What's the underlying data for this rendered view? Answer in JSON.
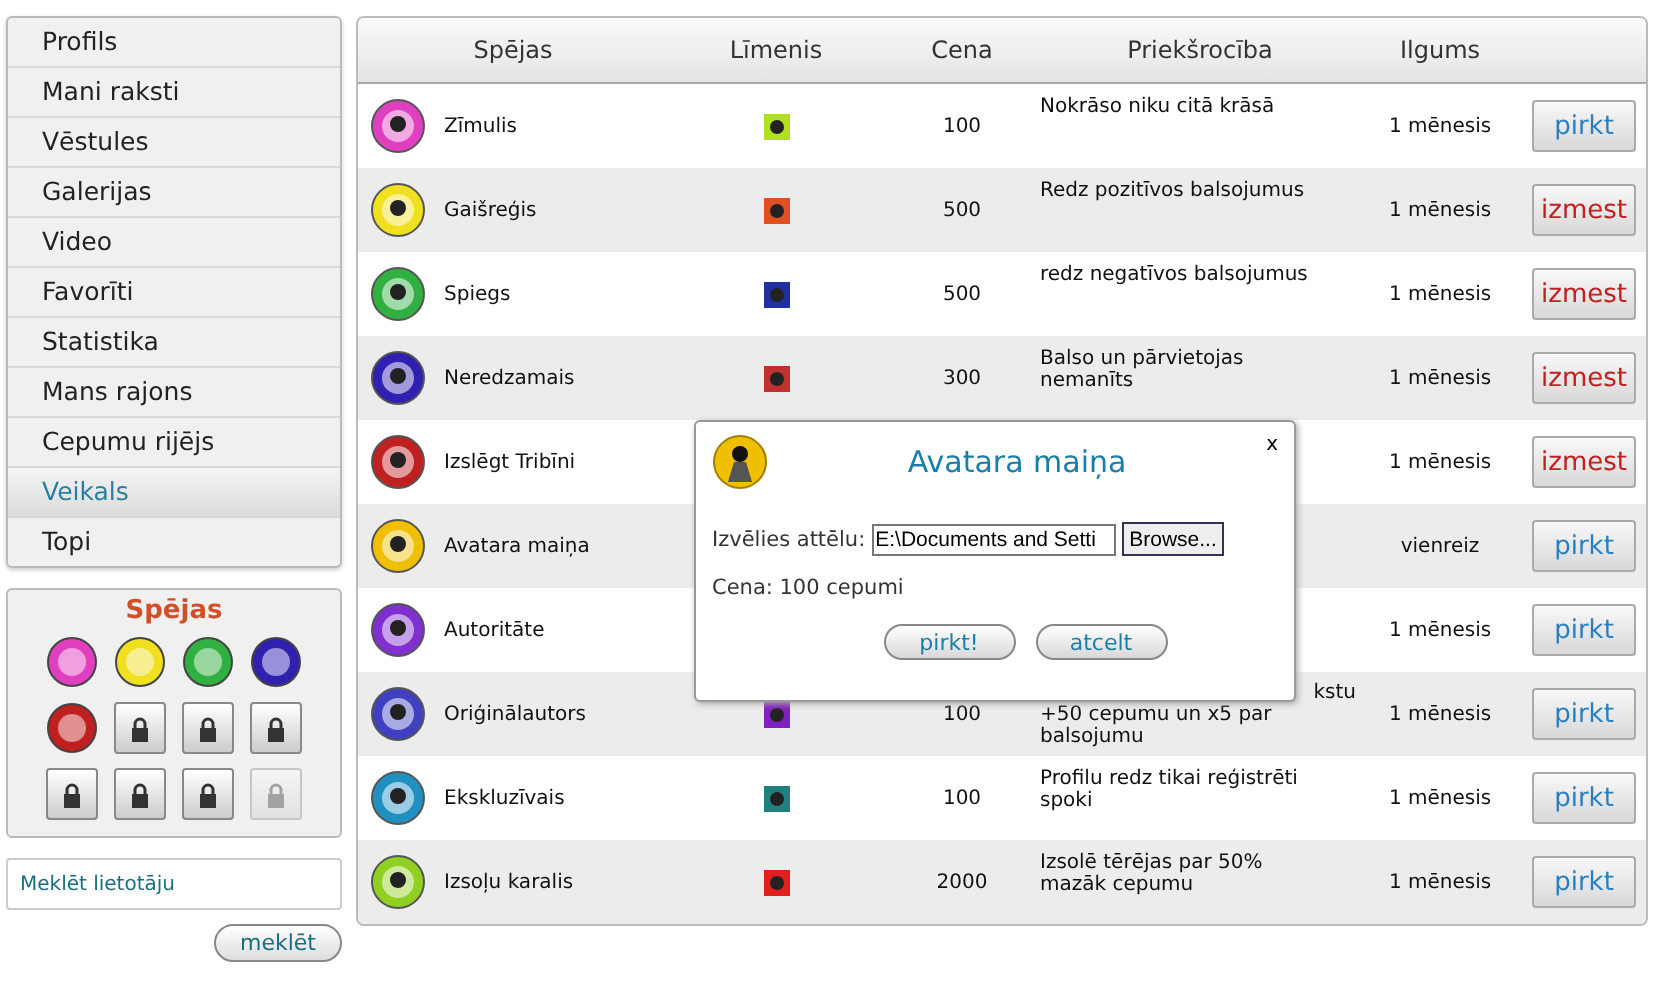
{
  "sidebar": {
    "items": [
      {
        "label": "Profils",
        "selected": false
      },
      {
        "label": "Mani raksti",
        "selected": false
      },
      {
        "label": "Vēstules",
        "selected": false
      },
      {
        "label": "Galerijas",
        "selected": false
      },
      {
        "label": "Video",
        "selected": false
      },
      {
        "label": "Favorīti",
        "selected": false
      },
      {
        "label": "Statistika",
        "selected": false
      },
      {
        "label": "Mans rajons",
        "selected": false
      },
      {
        "label": "Cepumu rijējs",
        "selected": false
      },
      {
        "label": "Veikals",
        "selected": true
      },
      {
        "label": "Topi",
        "selected": false
      }
    ]
  },
  "abilities_panel": {
    "title": "Spējas",
    "slots": [
      {
        "kind": "ability",
        "color": "#e040c0"
      },
      {
        "kind": "ability",
        "color": "#f0e020"
      },
      {
        "kind": "ability",
        "color": "#30b040"
      },
      {
        "kind": "ability",
        "color": "#3020b0"
      },
      {
        "kind": "ability",
        "color": "#c02020"
      },
      {
        "kind": "lock",
        "disabled": false
      },
      {
        "kind": "lock",
        "disabled": false
      },
      {
        "kind": "lock",
        "disabled": false
      },
      {
        "kind": "lock",
        "disabled": false
      },
      {
        "kind": "lock",
        "disabled": false
      },
      {
        "kind": "lock",
        "disabled": false
      },
      {
        "kind": "lock",
        "disabled": true
      }
    ]
  },
  "user_search": {
    "placeholder": "Meklēt lietotāju",
    "button": "meklēt"
  },
  "table": {
    "columns": [
      "Spējas",
      "Līmenis",
      "Cena",
      "Priekšrocība",
      "Ilgums"
    ],
    "rows": [
      {
        "name": "Zīmulis",
        "color": "#e040c0",
        "level": {
          "color": "#b0e020"
        },
        "price": "100",
        "benefit": "Nokrāso niku citā krāsā",
        "duration": "1 mēnesis",
        "action": {
          "kind": "buy",
          "label": "pirkt"
        }
      },
      {
        "name": "Gaišreģis",
        "color": "#f0e020",
        "level": {
          "color": "#e05020"
        },
        "price": "500",
        "benefit": "Redz pozitīvos balsojumus",
        "duration": "1 mēnesis",
        "action": {
          "kind": "remove",
          "label": "izmest"
        }
      },
      {
        "name": "Spiegs",
        "color": "#30b040",
        "level": {
          "color": "#2030a0"
        },
        "price": "500",
        "benefit": "redz negatīvos balsojumus",
        "duration": "1 mēnesis",
        "action": {
          "kind": "remove",
          "label": "izmest"
        }
      },
      {
        "name": "Neredzamais",
        "color": "#3020b0",
        "level": {
          "color": "#c03030"
        },
        "price": "300",
        "benefit": "Balso un pārvietojas nemanīts",
        "duration": "1 mēnesis",
        "action": {
          "kind": "remove",
          "label": "izmest"
        }
      },
      {
        "name": "Izslēgt Tribīni",
        "color": "#c02020",
        "duration": "1 mēnesis",
        "action": {
          "kind": "remove",
          "label": "izmest"
        }
      },
      {
        "name": "Avatara maiņa",
        "color": "#f0c000",
        "duration": "vienreiz",
        "action": {
          "kind": "buy",
          "label": "pirkt"
        }
      },
      {
        "name": "Autoritāte",
        "color": "#8030d0",
        "duration": "1 mēnesis",
        "action": {
          "kind": "buy",
          "label": "pirkt"
        }
      },
      {
        "name": "Oriģinālautors",
        "color": "#4040c0",
        "level": {
          "color": "#8020c0"
        },
        "price": "100",
        "benefit_cut": "kstu",
        "benefit": "+50 cepumu un x5 par balsojumu",
        "duration": "1 mēnesis",
        "action": {
          "kind": "buy",
          "label": "pirkt"
        }
      },
      {
        "name": "Ekskluzīvais",
        "color": "#2090c0",
        "level": {
          "color": "#208080"
        },
        "price": "100",
        "benefit": "Profilu redz tikai reģistrēti spoki",
        "duration": "1 mēnesis",
        "action": {
          "kind": "buy",
          "label": "pirkt"
        }
      },
      {
        "name": "Izsoļu karalis",
        "color": "#90d020",
        "level": {
          "color": "#e02020"
        },
        "price": "2000",
        "benefit": "Izsolē tērējas par 50% mazāk cepumu",
        "duration": "1 mēnesis",
        "action": {
          "kind": "buy",
          "label": "pirkt"
        }
      }
    ]
  },
  "dialog": {
    "title": "Avatara maiņa",
    "close": "x",
    "file_label": "Izvēlies attēlu:",
    "file_value": "E:\\Documents and Setti",
    "browse": "Browse...",
    "price": "Cena: 100 cepumi",
    "buttons": [
      "pirkt!",
      "atcelt"
    ]
  }
}
